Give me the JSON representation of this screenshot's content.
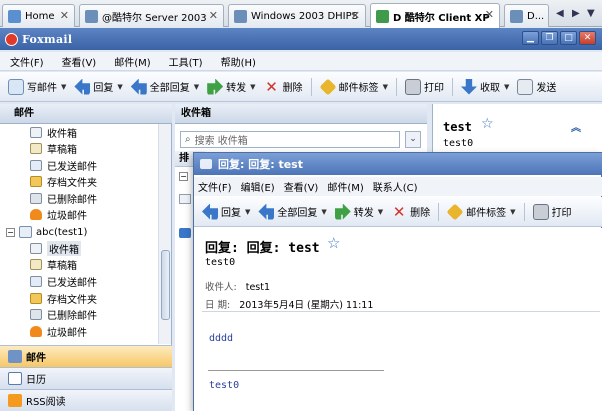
{
  "host_tabs": [
    {
      "label": "Home",
      "icon": "home-icon"
    },
    {
      "label": "@酷特尔 Server 2003",
      "icon": "vm-icon"
    },
    {
      "label": "Windows 2003 DHIPS",
      "icon": "vm-icon"
    },
    {
      "label": "D 酷特尔 Client XP",
      "icon": "vm-icon"
    },
    {
      "label": "D...",
      "icon": "vm-icon"
    }
  ],
  "app": {
    "title": "Foxmail"
  },
  "menu": [
    "文件(F)",
    "查看(V)",
    "邮件(M)",
    "工具(T)",
    "帮助(H)"
  ],
  "toolbar": {
    "compose": "写邮件",
    "reply": "回复",
    "reply_all": "全部回复",
    "forward": "转发",
    "delete": "删除",
    "tag": "邮件标签",
    "print": "打印",
    "receive": "收取",
    "send": "发送"
  },
  "left_pane": {
    "header": "邮件",
    "folders_top": [
      "收件箱",
      "草稿箱",
      "已发送邮件",
      "存档文件夹",
      "已删除邮件",
      "垃圾邮件"
    ],
    "account": "abc(test1)",
    "folders_account": [
      "收件箱",
      "草稿箱",
      "已发送邮件",
      "存档文件夹",
      "已删除邮件",
      "垃圾邮件"
    ],
    "nav_tabs": [
      "邮件",
      "日历",
      "RSS阅读"
    ]
  },
  "list_pane": {
    "header": "收件箱",
    "search_placeholder": "搜索 收件箱",
    "sort_label": "排"
  },
  "preview": {
    "title": "test",
    "subtitle": "test0"
  },
  "reply_window": {
    "title": "回复: 回复: test",
    "menu": [
      "文件(F)",
      "编辑(E)",
      "查看(V)",
      "邮件(M)",
      "联系人(C)"
    ],
    "toolbar": {
      "reply": "回复",
      "reply_all": "全部回复",
      "forward": "转发",
      "delete": "删除",
      "tag": "邮件标签",
      "print": "打印"
    },
    "subject": "回复: 回复: test",
    "from": "test0",
    "recipient_label": "收件人:",
    "recipient": "test1",
    "date_label": "日  期:",
    "date": "2013年5月4日 (星期六) 11:11",
    "body": "dddd",
    "quote": "test0"
  },
  "colors": {
    "titlebar": "#4a72b5",
    "selection": "#dfe6ee",
    "active_nav": "#f6c766",
    "link_text": "#2a3f9a"
  }
}
